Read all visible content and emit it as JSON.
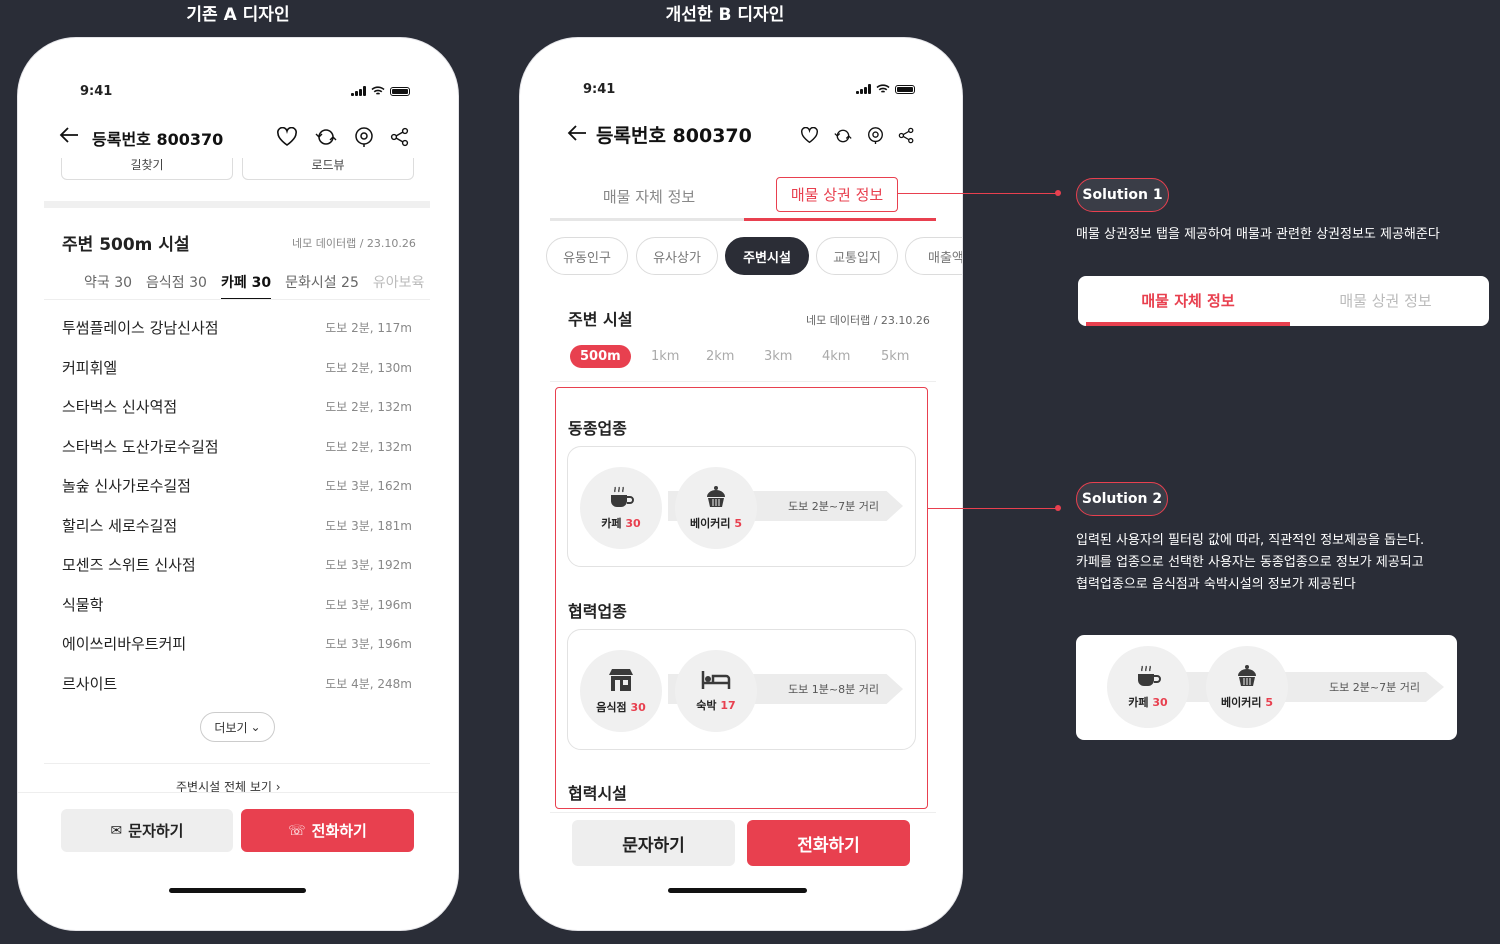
{
  "captions": {
    "left": "기존 A 디자인",
    "right": "개선한 B 디자인"
  },
  "status": {
    "time": "9:41"
  },
  "phone_a": {
    "header_title": "등록번호 800370",
    "top_buttons": [
      "길찾기",
      "로드뷰"
    ],
    "section_title": "주변 500m 시설",
    "source": "네모 데이터랩 / 23.10.26",
    "tabs": [
      "약국 30",
      "음식점 30",
      "카페 30",
      "문화시설 25",
      "유아보육"
    ],
    "active_tab": "카페 30",
    "rows": [
      {
        "name": "투썸플레이스 강남신사점",
        "dist": "도보 2분, 117m"
      },
      {
        "name": "커피휘엘",
        "dist": "도보 2분, 130m"
      },
      {
        "name": "스타벅스 신사역점",
        "dist": "도보 2분, 132m"
      },
      {
        "name": "스타벅스 도산가로수길점",
        "dist": "도보 2분, 132m"
      },
      {
        "name": "놀숲 신사가로수길점",
        "dist": "도보 3분, 162m"
      },
      {
        "name": "할리스 세로수길점",
        "dist": "도보 3분, 181m"
      },
      {
        "name": "모센즈 스위트 신사점",
        "dist": "도보 3분, 192m"
      },
      {
        "name": "식물학",
        "dist": "도보 3분, 196m"
      },
      {
        "name": "에이쓰리바우트커피",
        "dist": "도보 3분, 196m"
      },
      {
        "name": "르사이트",
        "dist": "도보 4분, 248m"
      }
    ],
    "more": "더보기",
    "view_all": "주변시설 전체 보기",
    "msg_button": "문자하기",
    "call_button": "전화하기"
  },
  "phone_b": {
    "header_title": "등록번호 800370",
    "tab_self": "매물 자체 정보",
    "tab_commerce": "매물 상권 정보",
    "chips": [
      "유동인구",
      "유사상가",
      "주변시설",
      "교통입지",
      "매출액"
    ],
    "active_chip": "주변시설",
    "section_title": "주변 시설",
    "source": "네모 데이터랩 / 23.10.26",
    "distances": [
      "500m",
      "1km",
      "2km",
      "3km",
      "4km",
      "5km"
    ],
    "same_industry": {
      "title": "동종업종",
      "items": [
        {
          "name": "카페",
          "count": "30"
        },
        {
          "name": "베이커리",
          "count": "5"
        }
      ],
      "range": "도보 2분~7분 거리"
    },
    "partner_industry": {
      "title": "협력업종",
      "items": [
        {
          "name": "음식점",
          "count": "30"
        },
        {
          "name": "숙박",
          "count": "17"
        }
      ],
      "range": "도보 1분~8분 거리"
    },
    "partner_facility_title": "협력시설",
    "msg_button": "문자하기",
    "call_button": "전화하기"
  },
  "solution1": {
    "badge": "Solution 1",
    "desc": "매물 상권정보 탭을 제공하여 매물과 관련한 상권정보도 제공해준다",
    "tab_self": "매물 자체 정보",
    "tab_commerce": "매물 상권 정보"
  },
  "solution2": {
    "badge": "Solution 2",
    "desc1": "입력된 사용자의 필터링 값에 따라, 직관적인 정보제공을 돕는다.",
    "desc2": "카페를 업종으로 선택한 사용자는 동종업종으로 정보가 제공되고",
    "desc3": "협력업종으로 음식점과 숙박시설의 정보가 제공된다",
    "items": [
      {
        "name": "카페",
        "count": "30"
      },
      {
        "name": "베이커리",
        "count": "5"
      }
    ],
    "range": "도보 2분~7분 거리"
  },
  "colors": {
    "accent": "#e8404f",
    "dark": "#2b2d36",
    "background": "#2a2d37"
  }
}
